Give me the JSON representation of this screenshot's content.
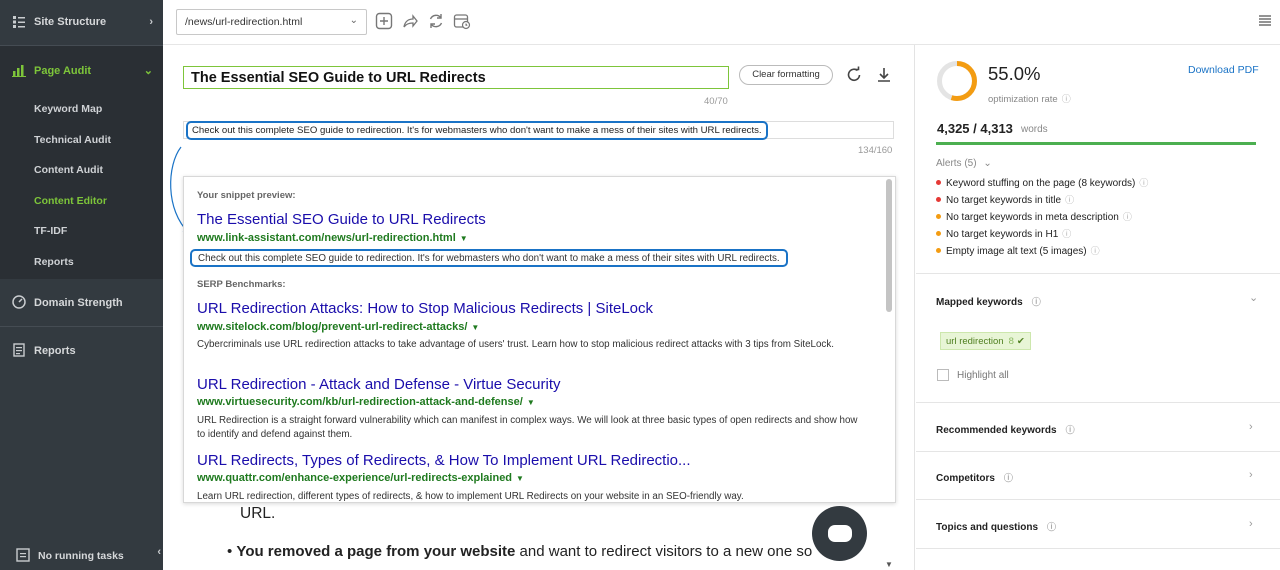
{
  "sidebar": {
    "items": [
      {
        "label": "Site Structure",
        "icon": "sitemap-icon"
      },
      {
        "label": "Page Audit",
        "icon": "page-audit-icon"
      },
      {
        "label": "Domain Strength",
        "icon": "gauge-icon"
      },
      {
        "label": "Reports",
        "icon": "reports-icon"
      }
    ],
    "subitems": [
      "Keyword Map",
      "Technical Audit",
      "Content Audit",
      "Content Editor",
      "TF-IDF",
      "Reports"
    ],
    "footer": "No running tasks",
    "accent": "#7dc53a",
    "bg": "#333a40"
  },
  "toolbar": {
    "url_value": "/news/url-redirection.html",
    "icons": [
      "add-icon",
      "share-icon",
      "refresh-icon",
      "schedule-icon",
      "menu-icon"
    ]
  },
  "editor": {
    "title_value": "The Essential SEO Guide to URL Redirects",
    "title_count": "40/70",
    "clear_formatting": "Clear formatting",
    "description_value": "Check out this complete SEO guide to redirection. It's for webmasters who don't want to make a mess of their sites with URL redirects.",
    "description_count": "134/160",
    "body_text_1": "URL.",
    "body_bold": "You removed a page from your website",
    "body_rest": " and want to redirect visitors to a new one so"
  },
  "snippet": {
    "preview_heading": "Your snippet preview:",
    "preview_title": "The Essential SEO Guide to URL Redirects",
    "preview_url": "www.link-assistant.com/news/url-redirection.html",
    "preview_desc": "Check out this complete SEO guide to redirection. It's for webmasters who don't want to make a mess of their sites with URL redirects.",
    "serp_heading": "SERP Benchmarks:",
    "serp": [
      {
        "title": "URL Redirection Attacks: How to Stop Malicious Redirects | SiteLock",
        "url": "www.sitelock.com/blog/prevent-url-redirect-attacks/",
        "desc": "Cybercriminals use URL redirection attacks to take advantage of users' trust. Learn how to stop malicious redirect attacks with 3 tips from SiteLock."
      },
      {
        "title": "URL Redirection - Attack and Defense - Virtue Security",
        "url": "www.virtuesecurity.com/kb/url-redirection-attack-and-defense/",
        "desc": "URL Redirection is a straight forward vulnerability which can manifest in complex ways. We will look at three basic types of open redirects and show how to identify and defend against them."
      },
      {
        "title": "URL Redirects, Types of Redirects, & How To Implement URL Redirectio...",
        "url": "www.quattr.com/enhance-experience/url-redirects-explained",
        "desc": "Learn URL redirection, different types of redirects, & how to implement URL Redirects on your website in an SEO-friendly way."
      }
    ]
  },
  "right": {
    "score": "55.0%",
    "score_value": 0.55,
    "score_label": "optimization rate",
    "download_pdf": "Download PDF",
    "words_num": "4,325 / 4,313",
    "words_label": "words",
    "alerts_heading": "Alerts (5)",
    "alerts": [
      {
        "text": "Keyword stuffing on the page (8 keywords)",
        "color": "#e53935"
      },
      {
        "text": "No target keywords in title",
        "color": "#e53935"
      },
      {
        "text": "No target keywords in meta description",
        "color": "#f39c12"
      },
      {
        "text": "No target keywords in H1",
        "color": "#f39c12"
      },
      {
        "text": "Empty image alt text (5 images)",
        "color": "#f39c12"
      }
    ],
    "mapped_keywords": "Mapped keywords",
    "keyword_chip": "url redirection",
    "keyword_count": "8",
    "highlight_all": "Highlight all",
    "sections": [
      "Recommended keywords",
      "Competitors",
      "Topics and questions"
    ],
    "gauge_color": "#f39c12"
  }
}
